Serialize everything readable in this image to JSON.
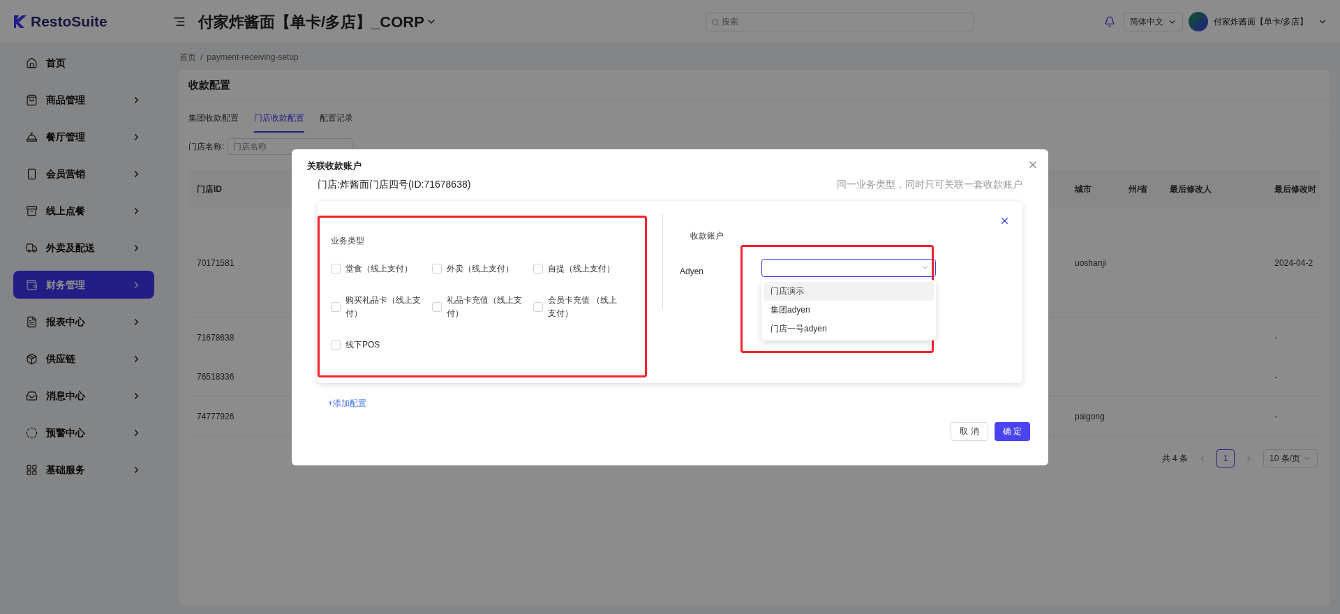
{
  "header": {
    "logo": "RestoSuite",
    "title": "付家炸酱面【单卡/多店】_CORP",
    "search": {
      "placeholder": "搜索"
    },
    "language": "简体中文",
    "user": "付家炸酱面【单卡/多店】"
  },
  "sidebar": {
    "items": [
      {
        "label": "首页",
        "selected": false,
        "has_children": false
      },
      {
        "label": "商品管理",
        "selected": false,
        "has_children": true
      },
      {
        "label": "餐厅管理",
        "selected": false,
        "has_children": true
      },
      {
        "label": "会员营销",
        "selected": false,
        "has_children": true
      },
      {
        "label": "线上点餐",
        "selected": false,
        "has_children": true
      },
      {
        "label": "外卖及配送",
        "selected": false,
        "has_children": true
      },
      {
        "label": "财务管理",
        "selected": true,
        "has_children": true
      },
      {
        "label": "报表中心",
        "selected": false,
        "has_children": true
      },
      {
        "label": "供应链",
        "selected": false,
        "has_children": true
      },
      {
        "label": "消息中心",
        "selected": false,
        "has_children": true
      },
      {
        "label": "预警中心",
        "selected": false,
        "has_children": true
      },
      {
        "label": "基础服务",
        "selected": false,
        "has_children": true
      }
    ]
  },
  "breadcrumb": {
    "separator": "/",
    "items": [
      "首页",
      "payment-receiving-setup"
    ]
  },
  "page": {
    "title": "收款配置",
    "tabs": [
      {
        "label": "集团收款配置",
        "selected": false
      },
      {
        "label": "门店收款配置",
        "selected": true
      },
      {
        "label": "配置记录",
        "selected": false
      }
    ],
    "filter": {
      "label": "门店名称:",
      "placeholder": "门店名称"
    },
    "table": {
      "columns_left": [
        "门店ID"
      ],
      "columns_right": [
        "城市",
        "州/省",
        "最后修改人",
        "最后修改时"
      ],
      "rows": [
        {
          "id": "70171581",
          "cells": [
            "uoshanji",
            "",
            "",
            "2024-04-2"
          ]
        },
        {
          "id": "71678638",
          "cells": [
            "",
            "",
            "",
            "-"
          ]
        },
        {
          "id": "76518336",
          "cells": [
            "",
            "",
            "",
            "-"
          ]
        },
        {
          "id": "74777926",
          "cells": [
            "paigong",
            "",
            "",
            "-"
          ]
        }
      ]
    },
    "pagination": {
      "total": "共 4 条",
      "pages": [
        {
          "label": "1",
          "selected": true
        }
      ],
      "page_size": "10 条/页"
    }
  },
  "dialog": {
    "title": "关联收款账户",
    "store": "门店:炸酱面门店四号(ID:71678638)",
    "hint": "同一业务类型，同时只可关联一套收款账户",
    "config": {
      "business_label": "业务类型",
      "options": [
        {
          "label": "堂食（线上支付）",
          "checked": false
        },
        {
          "label": "外卖（线上支付）",
          "checked": false
        },
        {
          "label": "自提（线上支付）",
          "checked": false
        },
        {
          "label": "购买礼品卡（线上支付）",
          "checked": false
        },
        {
          "label": "礼品卡充值（线上支付）",
          "checked": false
        },
        {
          "label": "会员卡充值 （线上支付）",
          "checked": false
        },
        {
          "label": "线下POS",
          "checked": false
        }
      ],
      "account_label": "收款账户",
      "provider": "Adyen",
      "dropdown": [
        {
          "label": "门店演示",
          "active": true
        },
        {
          "label": "集团adyen",
          "active": false
        },
        {
          "label": "门店一号adyen",
          "active": false
        }
      ]
    },
    "add_link": "+添加配置",
    "cancel": "取 消",
    "ok": "确 定"
  }
}
